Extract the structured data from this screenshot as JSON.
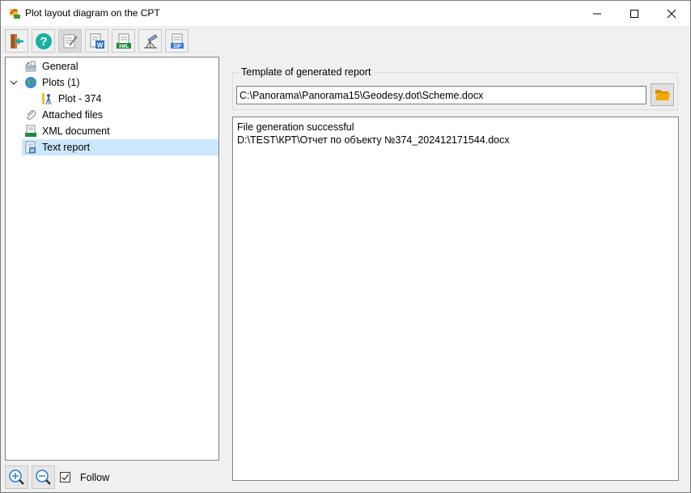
{
  "window": {
    "title": "Plot layout diagram on the CPT",
    "icon": "app-icon",
    "controls": [
      {
        "name": "minimize",
        "icon": "minimize-icon"
      },
      {
        "name": "maximize",
        "icon": "maximize-icon"
      },
      {
        "name": "close",
        "icon": "close-icon"
      }
    ]
  },
  "toolbar": {
    "buttons": [
      {
        "name": "exit",
        "icon": "exit-door-icon",
        "pressed": false
      },
      {
        "name": "help",
        "icon": "help-icon",
        "pressed": false
      },
      {
        "name": "edit",
        "icon": "edit-document-icon",
        "pressed": true
      },
      {
        "name": "word",
        "icon": "word-document-icon",
        "pressed": false
      },
      {
        "name": "xml",
        "icon": "xml-document-icon",
        "pressed": false
      },
      {
        "name": "survey",
        "icon": "survey-instrument-icon",
        "pressed": false
      },
      {
        "name": "zip",
        "icon": "zip-archive-icon",
        "pressed": false
      }
    ]
  },
  "tree": {
    "items": [
      {
        "label": "General",
        "icon": "general-icon",
        "level": 0,
        "selected": false
      },
      {
        "label": "Plots (1)",
        "icon": "globe-icon",
        "level": 0,
        "expanded": true,
        "selected": false
      },
      {
        "label": "Plot - 374",
        "icon": "plot-survey-icon",
        "level": 1,
        "selected": false
      },
      {
        "label": "Attached files",
        "icon": "paperclip-icon",
        "level": 0,
        "selected": false
      },
      {
        "label": "XML document",
        "icon": "xml-icon",
        "level": 0,
        "selected": false
      },
      {
        "label": "Text report",
        "icon": "word-icon",
        "level": 0,
        "selected": true
      }
    ]
  },
  "bottom": {
    "zoom_in_icon": "zoom-in-icon",
    "zoom_out_icon": "zoom-out-icon",
    "follow_label": "Follow",
    "follow_checked": true
  },
  "report": {
    "group_label": "Template of generated report",
    "template_path": "C:\\Panorama\\Panorama15\\Geodesy.dot\\Scheme.docx",
    "browse_icon": "folder-icon"
  },
  "log": {
    "lines": [
      "File generation successful",
      "D:\\TEST\\КРТ\\Отчет по объекту №374_202412171544.docx"
    ]
  },
  "colors": {
    "selection": "#cce8ff",
    "window_bg": "#f0f0f0",
    "folder": "#f5a800"
  }
}
